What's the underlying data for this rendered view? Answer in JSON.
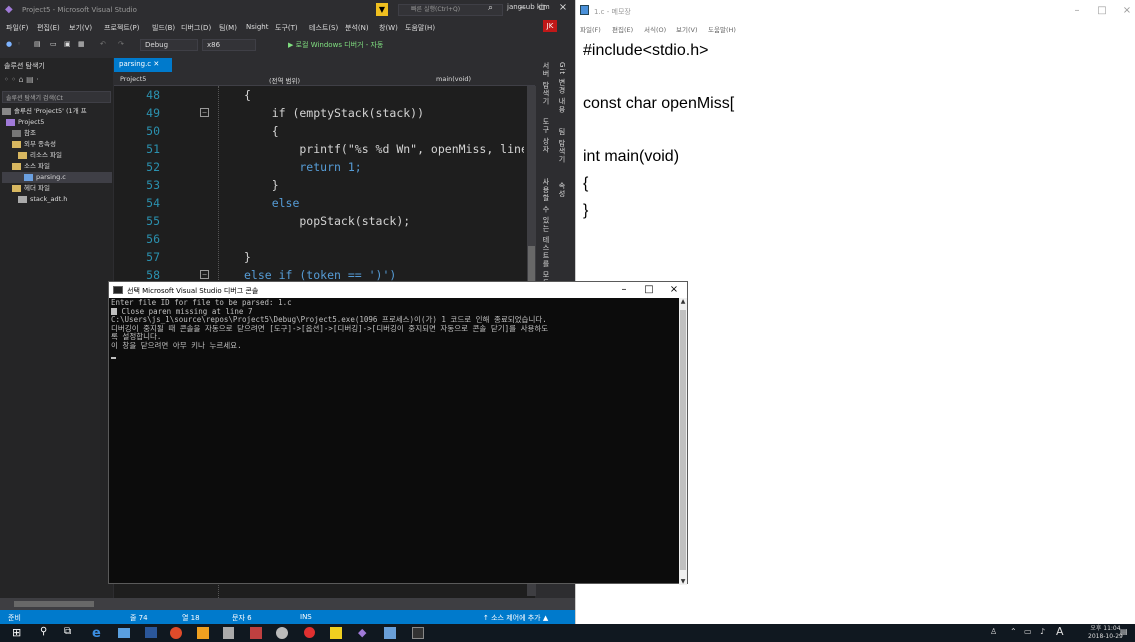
{
  "vs": {
    "title": "Project5 - Microsoft Visual Studio",
    "quick_launch": "빠른 실행(Ctrl+Q)",
    "menu": [
      "파일(F)",
      "편집(E)",
      "보기(V)",
      "프로젝트(P)",
      "빌드(B)",
      "디버그(D)",
      "팀(M)",
      "Nsight",
      "도구(T)",
      "테스트(S)",
      "분석(N)",
      "창(W)",
      "도움말(H)"
    ],
    "account": "jangsub kim",
    "account_initials": "JK",
    "toolbar": {
      "config": "Debug",
      "platform": "x86",
      "run_label": "▶ 로컬 Windows 디버거 - 자동"
    },
    "solution_explorer": {
      "title": "솔루션 탐색기",
      "search_placeholder": "솔루션 탐색기 검색(Ct",
      "tree": [
        "솔루션 'Project5' (1개 프",
        "Project5",
        "참조",
        "외부 종속성",
        "리소스 파일",
        "소스 파일",
        "parsing.c",
        "헤더 파일",
        "stack_adt.h"
      ]
    },
    "editor": {
      "tab": "parsing.c",
      "nav_project": "Project5",
      "nav_scope": "(전역 범위)",
      "nav_func": "main(void)",
      "lines": [
        {
          "n": "48",
          "t": "{"
        },
        {
          "n": "49",
          "t": "    if (emptyStack(stack))"
        },
        {
          "n": "50",
          "t": "    {"
        },
        {
          "n": "51",
          "t": "        printf(\"%s %d Wn\", openMiss, lineCou"
        },
        {
          "n": "52",
          "t": "        return 1;"
        },
        {
          "n": "53",
          "t": "    }"
        },
        {
          "n": "54",
          "t": "    else"
        },
        {
          "n": "55",
          "t": "        popStack(stack);"
        },
        {
          "n": "56",
          "t": ""
        },
        {
          "n": "57",
          "t": "}"
        },
        {
          "n": "58",
          "t": "else if (token == ')')"
        },
        {
          "n": "59",
          "t": "{"
        }
      ]
    },
    "side_tabs": [
      "서버 탐색기",
      "도구 상자",
      "Git 변경 내용",
      "팀 탐색기",
      "속성",
      "사용할 수 있는 테스트를 모두 찾으려면"
    ],
    "status": {
      "ready": "준비",
      "line": "줄 74",
      "col": "열 18",
      "char": "문자 6",
      "ins": "INS",
      "source_control": "↑ 소스 제어에 추가 ▲"
    }
  },
  "console": {
    "title": "선택 Microsoft Visual Studio 디버그 콘솔",
    "lines": [
      "Enter file ID for file to be parsed: 1.c",
      "Close paren missing at line 7",
      "",
      "C:\\Users\\js_1\\source\\repos\\Project5\\Debug\\Project5.exe(1096 프로세스)이(가) 1 코드로 인해 종료되었습니다.",
      "디버깅이 중지될 때 콘솔을 자동으로 닫으려면 [도구]->[옵션]->[디버깅]->[디버깅이 중지되면 자동으로 콘솔 닫기]를 사용하도",
      "록 설정합니다.",
      "이 창을 닫으려면 아무 키나 누르세요."
    ]
  },
  "notepad": {
    "title": "1.c - 메모장",
    "menu": [
      "파일(F)",
      "편집(E)",
      "서식(O)",
      "보기(V)",
      "도움말(H)"
    ],
    "text": "#include<stdio.h>\n\nconst char openMiss[\n\nint main(void)\n{\n}"
  },
  "taskbar": {
    "tray_text": "A",
    "clock_time": "오후 11:04",
    "clock_date": "2018-10-29"
  }
}
